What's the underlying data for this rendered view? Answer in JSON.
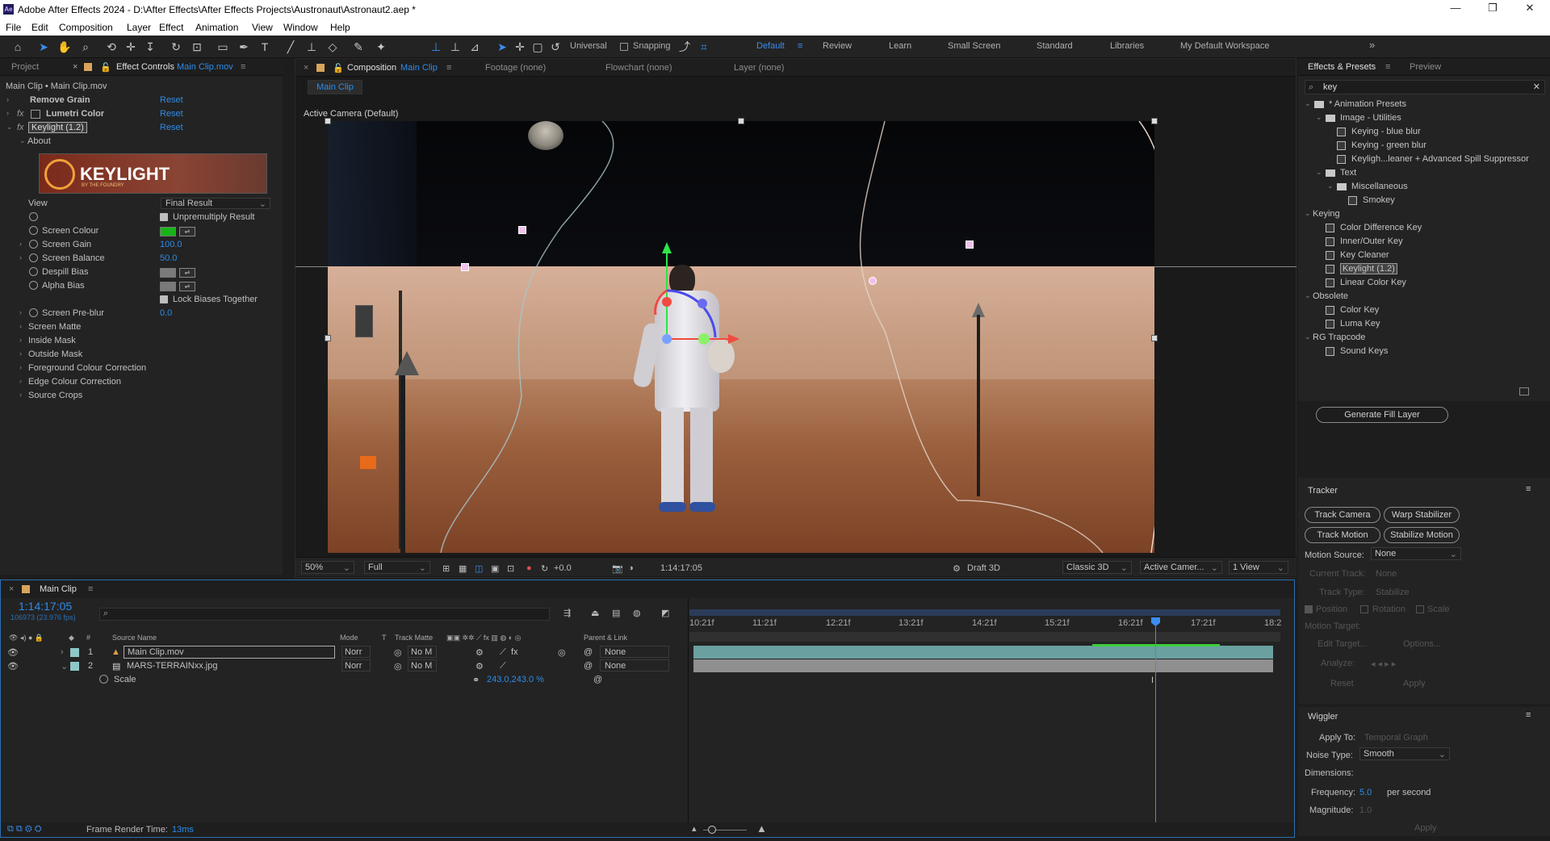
{
  "app": {
    "title": "Adobe After Effects 2024 - D:\\After Effects\\After Effects Projects\\Austronaut\\Astronaut2.aep *",
    "menu": [
      "File",
      "Edit",
      "Composition",
      "Layer",
      "Effect",
      "Animation",
      "View",
      "Window",
      "Help"
    ]
  },
  "toolbar": {
    "universal": "Universal",
    "snapping": "Snapping",
    "workspaces": [
      "Default",
      "Review",
      "Learn",
      "Small Screen",
      "Standard",
      "Libraries",
      "My Default Workspace"
    ],
    "active_workspace": "Default"
  },
  "left_panel": {
    "tab_project": "Project",
    "tab_effect_controls": "Effect Controls",
    "tab_effect_target": "Main Clip.mov",
    "breadcrumb": "Main Clip • Main Clip.mov",
    "effects": [
      {
        "name": "Remove Grain",
        "reset": "Reset"
      },
      {
        "name": "Lumetri Color",
        "reset": "Reset"
      },
      {
        "name": "Keylight (1.2)",
        "reset": "Reset"
      }
    ],
    "about": "About",
    "logo_text": "KEYLIGHT",
    "logo_sub": "BY THE FOUNDRY",
    "view_label": "View",
    "view_value": "Final Result",
    "unpremultiply": "Unpremultiply Result",
    "screen_colour": "Screen Colour",
    "screen_gain_label": "Screen Gain",
    "screen_gain": "100.0",
    "screen_balance_label": "Screen Balance",
    "screen_balance": "50.0",
    "despill_bias": "Despill Bias",
    "alpha_bias": "Alpha Bias",
    "lock_biases": "Lock Biases Together",
    "screen_preblur_label": "Screen Pre-blur",
    "screen_preblur": "0.0",
    "groups": [
      "Screen Matte",
      "Inside Mask",
      "Outside Mask",
      "Foreground Colour Correction",
      "Edge Colour Correction",
      "Source Crops"
    ],
    "screen_colour_hex": "#19b319"
  },
  "comp": {
    "tab_label": "Composition",
    "tab_name": "Main Clip",
    "footage": "Footage (none)",
    "flowchart": "Flowchart (none)",
    "layer": "Layer (none)",
    "sub_tab": "Main Clip",
    "camera_label": "Active Camera (Default)",
    "zoom": "50%",
    "resolution": "Full",
    "exposure": "+0.0",
    "timecode": "1:14:17:05",
    "renderer": "Draft 3D",
    "renderer_mode": "Classic 3D",
    "camera": "Active Camer...",
    "views": "1 View"
  },
  "effects_presets": {
    "tab": "Effects & Presets",
    "tab_preview": "Preview",
    "search": "key",
    "tree": [
      {
        "label": "* Animation Presets",
        "level": 0,
        "kind": "folder-open"
      },
      {
        "label": "Image - Utilities",
        "level": 1,
        "kind": "folder-open"
      },
      {
        "label": "Keying - blue blur",
        "level": 2,
        "kind": "preset"
      },
      {
        "label": "Keying - green blur",
        "level": 2,
        "kind": "preset"
      },
      {
        "label": "Keyligh...leaner + Advanced Spill Suppressor",
        "level": 2,
        "kind": "preset"
      },
      {
        "label": "Text",
        "level": 1,
        "kind": "folder-open"
      },
      {
        "label": "Miscellaneous",
        "level": 2,
        "kind": "folder-open"
      },
      {
        "label": "Smokey",
        "level": 3,
        "kind": "preset"
      },
      {
        "label": "Keying",
        "level": 0,
        "kind": "category"
      },
      {
        "label": "Color Difference Key",
        "level": 1,
        "kind": "effect"
      },
      {
        "label": "Inner/Outer Key",
        "level": 1,
        "kind": "effect"
      },
      {
        "label": "Key Cleaner",
        "level": 1,
        "kind": "effect"
      },
      {
        "label": "Keylight (1.2)",
        "level": 1,
        "kind": "effect",
        "selected": true
      },
      {
        "label": "Linear Color Key",
        "level": 1,
        "kind": "effect"
      },
      {
        "label": "Obsolete",
        "level": 0,
        "kind": "category"
      },
      {
        "label": "Color Key",
        "level": 1,
        "kind": "effect"
      },
      {
        "label": "Luma Key",
        "level": 1,
        "kind": "effect"
      },
      {
        "label": "RG Trapcode",
        "level": 0,
        "kind": "category"
      },
      {
        "label": "Sound Keys",
        "level": 1,
        "kind": "effect"
      }
    ],
    "generate_fill": "Generate Fill Layer"
  },
  "tracker": {
    "title": "Tracker",
    "track_camera": "Track Camera",
    "warp_stabilizer": "Warp Stabilizer",
    "track_motion": "Track Motion",
    "stabilize_motion": "Stabilize Motion",
    "motion_source_label": "Motion Source:",
    "motion_source": "None",
    "current_track_label": "Current Track:",
    "current_track": "None",
    "track_type_label": "Track Type:",
    "track_type": "Stabilize",
    "position": "Position",
    "rotation": "Rotation",
    "scale": "Scale",
    "motion_target": "Motion Target:",
    "edit_target": "Edit Target...",
    "options": "Options...",
    "analyze": "Analyze:",
    "reset": "Reset",
    "apply": "Apply"
  },
  "wiggler": {
    "title": "Wiggler",
    "apply_to_label": "Apply To:",
    "apply_to": "Temporal Graph",
    "noise_type_label": "Noise Type:",
    "noise_type": "Smooth",
    "dimensions_label": "Dimensions:",
    "frequency_label": "Frequency:",
    "frequency": "5.0",
    "per_second": "per second",
    "magnitude_label": "Magnitude:",
    "magnitude": "1.0",
    "apply": "Apply"
  },
  "timeline": {
    "tab": "Main Clip",
    "timecode": "1:14:17:05",
    "frames": "106973 (23.976 fps)",
    "columns": [
      "Source Name",
      "Mode",
      "T",
      "Track Matte",
      "Parent & Link"
    ],
    "layers": [
      {
        "num": "1",
        "name": "Main Clip.mov",
        "mode": "Norr",
        "matte": "No M",
        "parent": "None",
        "color": "#8fc7c7"
      },
      {
        "num": "2",
        "name": "MARS-TERRAINxx.jpg",
        "mode": "Norr",
        "matte": "No M",
        "parent": "None",
        "color": "#8fc7c7"
      }
    ],
    "scale_label": "Scale",
    "scale_value": "243.0,243.0 %",
    "ruler": [
      "10:21f",
      "11:21f",
      "12:21f",
      "13:21f",
      "14:21f",
      "15:21f",
      "16:21f",
      "17:21f",
      "18:2"
    ],
    "frame_render_label": "Frame Render Time:",
    "frame_render_value": "13ms"
  }
}
